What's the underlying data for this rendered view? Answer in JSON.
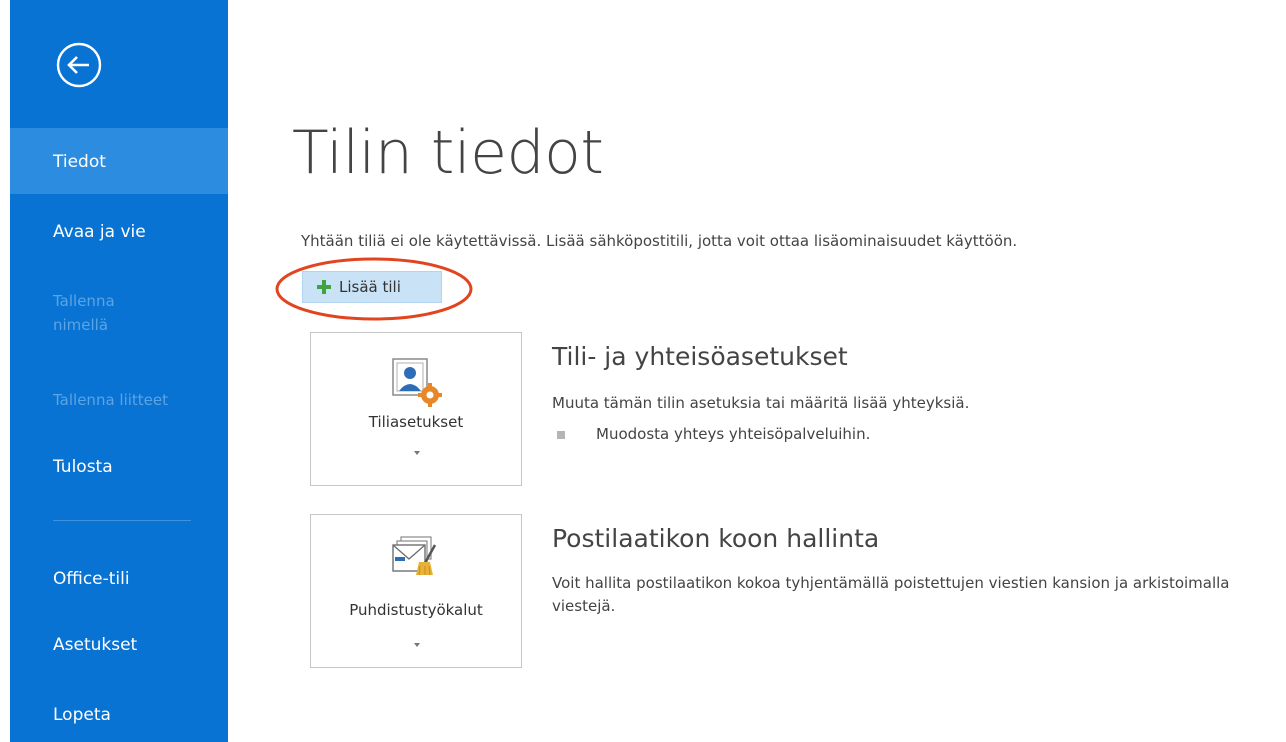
{
  "sidebar": {
    "items": [
      {
        "label": "Tiedot"
      },
      {
        "label": "Avaa ja vie"
      },
      {
        "label": "Tallenna nimellä"
      },
      {
        "label": "Tallenna liitteet"
      },
      {
        "label": "Tulosta"
      },
      {
        "label": "Office-tili"
      },
      {
        "label": "Asetukset"
      },
      {
        "label": "Lopeta"
      }
    ]
  },
  "main": {
    "title": "Tilin tiedot",
    "info": "Yhtään tiliä ei ole käytettävissä. Lisää sähköpostitili, jotta voit ottaa lisäominaisuudet käyttöön.",
    "add_account_label": "Lisää tili",
    "sections": [
      {
        "tile_label": "Tiliasetukset",
        "heading": "Tili- ja yhteisöasetukset",
        "description": "Muuta tämän tilin asetuksia tai määritä lisää yhteyksiä.",
        "bullet": "Muodosta yhteys yhteisöpalveluihin."
      },
      {
        "tile_label": "Puhdistustyökalut",
        "heading": "Postilaatikon koon hallinta",
        "description": "Voit hallita postilaatikon kokoa tyhjentämällä poistettujen viestien kansion ja arkistoimalla viestejä."
      }
    ]
  },
  "colors": {
    "sidebar_bg": "#0873d3",
    "sidebar_selected": "#2b8ce0",
    "highlight": "#e2441f",
    "add_button_bg": "#c9e2f6"
  },
  "icons": {
    "back": "back-arrow-circle-icon",
    "add": "plus-icon",
    "account_settings": "account-settings-icon",
    "cleanup": "cleanup-tools-icon"
  }
}
